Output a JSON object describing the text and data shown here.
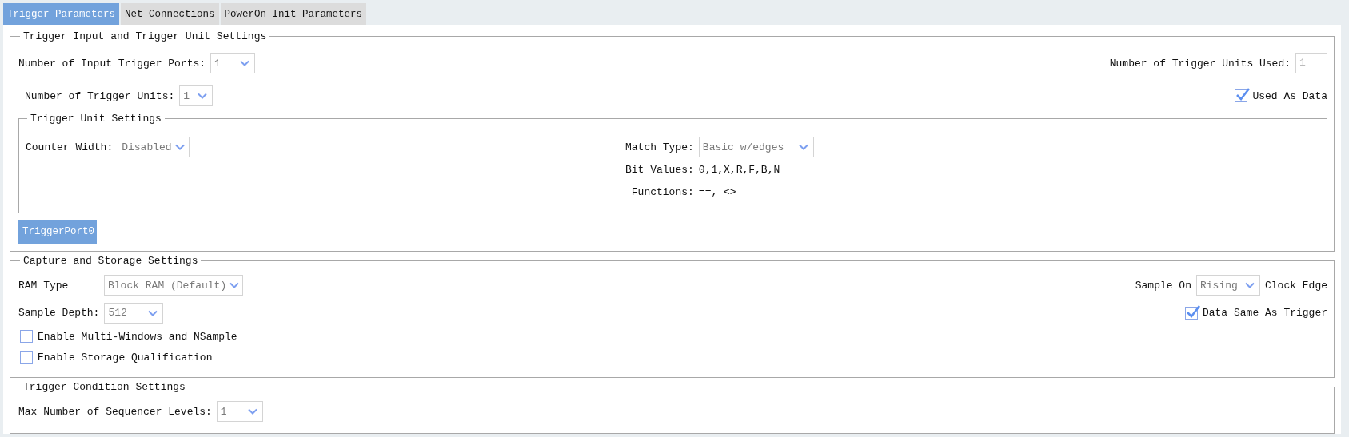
{
  "tabs": [
    {
      "label": "Trigger Parameters",
      "selected": true
    },
    {
      "label": "Net Connections",
      "selected": false
    },
    {
      "label": "PowerOn Init Parameters",
      "selected": false
    }
  ],
  "trigger_input": {
    "title": "Trigger Input and Trigger Unit Settings",
    "input_ports": {
      "label": "Number of Input Trigger Ports:",
      "value": "1"
    },
    "units_used": {
      "label": "Number of Trigger Units Used:",
      "value": "1",
      "disabled": true
    },
    "trigger_units": {
      "label": "Number of Trigger Units:",
      "value": "1"
    },
    "used_as_data": {
      "label": "Used As Data",
      "checked": true
    },
    "unit_settings": {
      "title": "Trigger Unit Settings",
      "counter_width": {
        "label": "Counter Width:",
        "value": "Disabled"
      },
      "match_type": {
        "label": "Match Type:",
        "value": "Basic w/edges"
      },
      "bit_values": {
        "label": "Bit Values:",
        "value": "0,1,X,R,F,B,N"
      },
      "functions": {
        "label": "Functions:",
        "value": "==, <>"
      }
    },
    "port_tabs": [
      {
        "label": "TriggerPort0",
        "selected": true
      }
    ]
  },
  "capture": {
    "title": "Capture and Storage Settings",
    "ram_type": {
      "label": "RAM Type",
      "value": "Block RAM (Default)"
    },
    "sample_depth": {
      "label": "Sample Depth:",
      "value": "512"
    },
    "options": [
      {
        "label": "Enable Multi-Windows and NSample",
        "checked": false
      },
      {
        "label": "Enable Storage Qualification",
        "checked": false
      }
    ],
    "sample_on": {
      "label": "Sample On",
      "value": "Rising",
      "suffix": "Clock Edge"
    },
    "data_same": {
      "label": "Data Same As Trigger",
      "checked": true
    }
  },
  "condition": {
    "title": "Trigger Condition Settings",
    "max_levels": {
      "label": "Max Number of Sequencer Levels:",
      "value": "1"
    }
  }
}
